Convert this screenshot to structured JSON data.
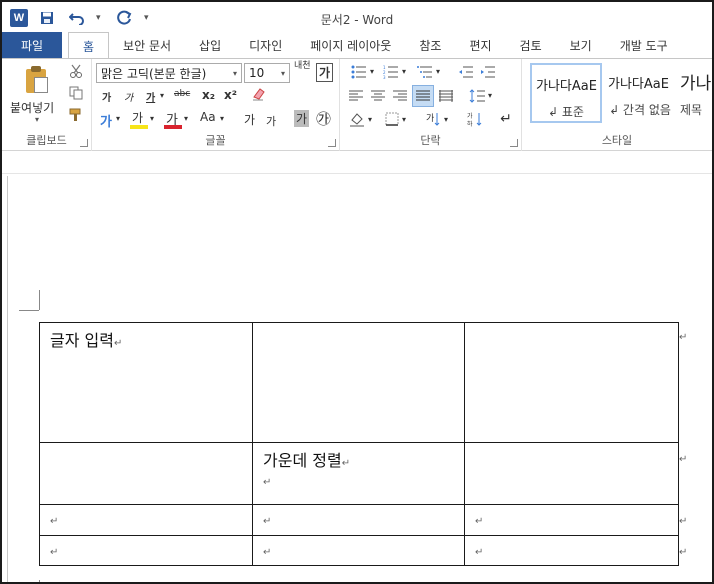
{
  "app": {
    "doc_title": "문서2 - Word",
    "logo_letter": "W"
  },
  "qat": {
    "more": "▾"
  },
  "tabs": [
    {
      "label": "파일"
    },
    {
      "label": "홈"
    },
    {
      "label": "보안 문서"
    },
    {
      "label": "삽입"
    },
    {
      "label": "디자인"
    },
    {
      "label": "페이지 레이아웃"
    },
    {
      "label": "참조"
    },
    {
      "label": "편지"
    },
    {
      "label": "검토"
    },
    {
      "label": "보기"
    },
    {
      "label": "개발 도구"
    }
  ],
  "ribbon": {
    "clipboard": {
      "paste_label": "붙여넣기",
      "group_label": "클립보드"
    },
    "font": {
      "font_name": "맑은 고딕(본문 한글)",
      "font_size": "10",
      "phonetic": "내천",
      "enlarge": "가",
      "shrink": "가",
      "bold": "가",
      "italic": "가",
      "underline": "가",
      "strike": "ᆉᆉᆉ",
      "subscript": "x₂",
      "superscript": "x²",
      "text_effect": "가",
      "highlight": "가",
      "font_color": "가",
      "change_case": "Aa",
      "char_border": "가",
      "char_shading": "가",
      "enclose": "㉮",
      "small_ga1": "가",
      "small_ga2": "가",
      "group_label": "글꼴",
      "highlight_color": "#f7e51a",
      "font_color_value": "#d9232e"
    },
    "paragraph": {
      "group_label": "단락"
    },
    "styles": {
      "items": [
        {
          "sample": "가나다AaE",
          "name": "↲ 표준"
        },
        {
          "sample": "가나다AaE",
          "name": "↲ 간격 없음"
        },
        {
          "sample": "가나",
          "name": "제목"
        }
      ],
      "group_label": "스타일"
    }
  },
  "document": {
    "table": {
      "rows": [
        [
          "글자 입력",
          "",
          ""
        ],
        [
          "",
          "가운데 정렬",
          ""
        ],
        [
          "",
          "",
          ""
        ],
        [
          "",
          "",
          ""
        ]
      ]
    },
    "paragraph_mark": "↵"
  }
}
